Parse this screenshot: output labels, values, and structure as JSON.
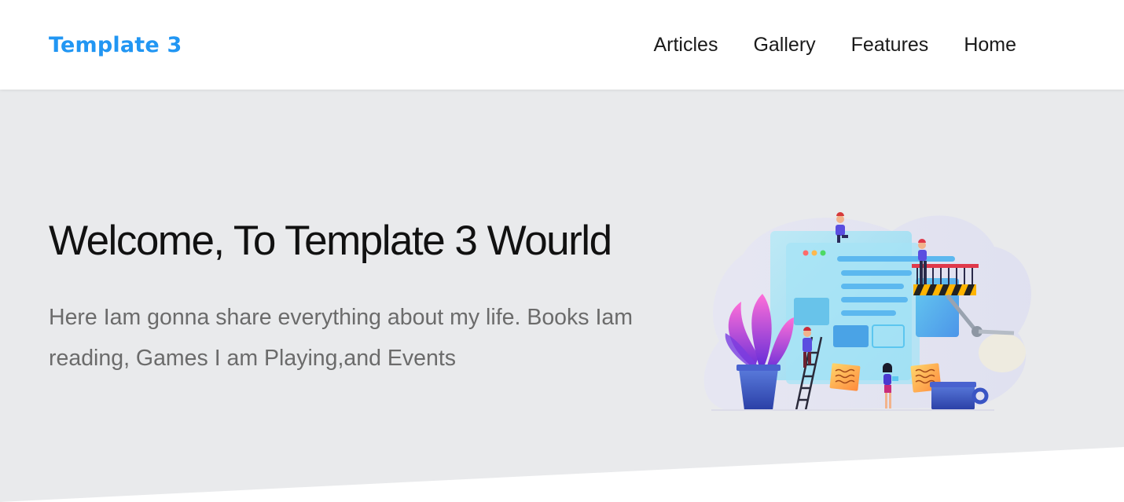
{
  "brand": {
    "name": "Template 3",
    "color": "#2196f3"
  },
  "nav": {
    "links": [
      "Articles",
      "Gallery",
      "Features",
      "Home"
    ]
  },
  "hero": {
    "title": "Welcome, To Template 3 Wourld",
    "text": "Here Iam gonna share everything about my life. Books Iam reading, Games I am Playing,and Events",
    "background": "#e9eaec",
    "illustration_icon": "web-design-team-illustration"
  }
}
